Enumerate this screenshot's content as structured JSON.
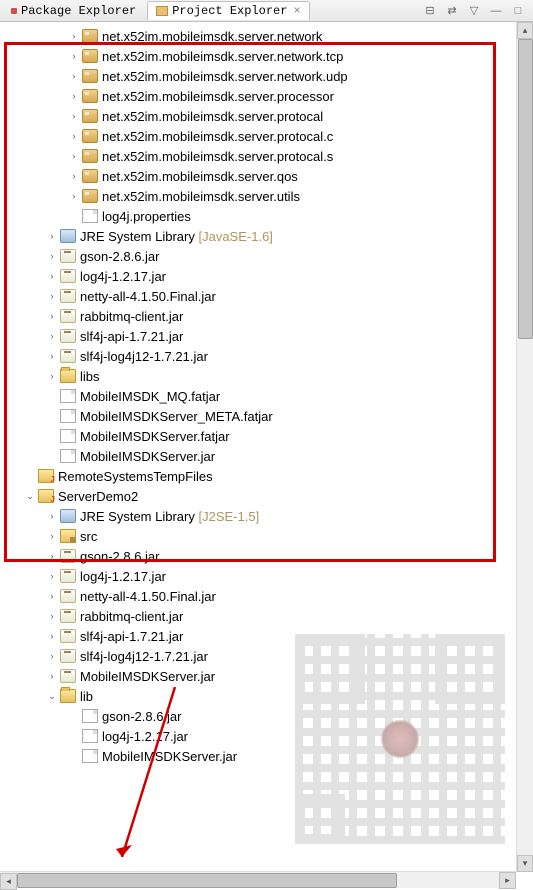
{
  "tabs": {
    "inactive": "Package Explorer",
    "active": "Project Explorer",
    "active_marker": "×"
  },
  "toolbar": {
    "collapse": "⊟",
    "link": "⇄",
    "menu": "▽",
    "min": "—",
    "max": "□"
  },
  "tree": [
    {
      "indent": 3,
      "exp": ">",
      "ico": "pkg",
      "text": "net.x52im.mobileimsdk.server.network"
    },
    {
      "indent": 3,
      "exp": ">",
      "ico": "pkg",
      "text": "net.x52im.mobileimsdk.server.network.tcp"
    },
    {
      "indent": 3,
      "exp": ">",
      "ico": "pkg",
      "text": "net.x52im.mobileimsdk.server.network.udp"
    },
    {
      "indent": 3,
      "exp": ">",
      "ico": "pkg",
      "text": "net.x52im.mobileimsdk.server.processor"
    },
    {
      "indent": 3,
      "exp": ">",
      "ico": "pkg",
      "text": "net.x52im.mobileimsdk.server.protocal"
    },
    {
      "indent": 3,
      "exp": ">",
      "ico": "pkg",
      "text": "net.x52im.mobileimsdk.server.protocal.c"
    },
    {
      "indent": 3,
      "exp": ">",
      "ico": "pkg",
      "text": "net.x52im.mobileimsdk.server.protocal.s"
    },
    {
      "indent": 3,
      "exp": ">",
      "ico": "pkg",
      "text": "net.x52im.mobileimsdk.server.qos"
    },
    {
      "indent": 3,
      "exp": ">",
      "ico": "pkg",
      "text": "net.x52im.mobileimsdk.server.utils"
    },
    {
      "indent": 3,
      "exp": "",
      "ico": "file",
      "text": "log4j.properties"
    },
    {
      "indent": 2,
      "exp": ">",
      "ico": "lib",
      "text": "JRE System Library",
      "deco": " [JavaSE-1.6]"
    },
    {
      "indent": 2,
      "exp": ">",
      "ico": "jar",
      "text": "gson-2.8.6.jar"
    },
    {
      "indent": 2,
      "exp": ">",
      "ico": "jar",
      "text": "log4j-1.2.17.jar"
    },
    {
      "indent": 2,
      "exp": ">",
      "ico": "jar",
      "text": "netty-all-4.1.50.Final.jar"
    },
    {
      "indent": 2,
      "exp": ">",
      "ico": "jar",
      "text": "rabbitmq-client.jar"
    },
    {
      "indent": 2,
      "exp": ">",
      "ico": "jar",
      "text": "slf4j-api-1.7.21.jar"
    },
    {
      "indent": 2,
      "exp": ">",
      "ico": "jar",
      "text": "slf4j-log4j12-1.7.21.jar"
    },
    {
      "indent": 2,
      "exp": ">",
      "ico": "folder",
      "text": "libs"
    },
    {
      "indent": 2,
      "exp": "",
      "ico": "file",
      "text": "MobileIMSDK_MQ.fatjar"
    },
    {
      "indent": 2,
      "exp": "",
      "ico": "file",
      "text": "MobileIMSDKServer_META.fatjar"
    },
    {
      "indent": 2,
      "exp": "",
      "ico": "file",
      "text": "MobileIMSDKServer.fatjar"
    },
    {
      "indent": 2,
      "exp": "",
      "ico": "file",
      "text": "MobileIMSDKServer.jar"
    },
    {
      "indent": 1,
      "exp": "",
      "ico": "proj",
      "text": "RemoteSystemsTempFiles"
    },
    {
      "indent": 1,
      "exp": "v",
      "ico": "proj",
      "text": "ServerDemo2"
    },
    {
      "indent": 2,
      "exp": ">",
      "ico": "lib",
      "text": "JRE System Library",
      "deco": " [J2SE-1.5]"
    },
    {
      "indent": 2,
      "exp": ">",
      "ico": "src",
      "text": "src"
    },
    {
      "indent": 2,
      "exp": ">",
      "ico": "jar",
      "text": "gson-2.8.6.jar"
    },
    {
      "indent": 2,
      "exp": ">",
      "ico": "jar",
      "text": "log4j-1.2.17.jar"
    },
    {
      "indent": 2,
      "exp": ">",
      "ico": "jar",
      "text": "netty-all-4.1.50.Final.jar"
    },
    {
      "indent": 2,
      "exp": ">",
      "ico": "jar",
      "text": "rabbitmq-client.jar"
    },
    {
      "indent": 2,
      "exp": ">",
      "ico": "jar",
      "text": "slf4j-api-1.7.21.jar"
    },
    {
      "indent": 2,
      "exp": ">",
      "ico": "jar",
      "text": "slf4j-log4j12-1.7.21.jar"
    },
    {
      "indent": 2,
      "exp": ">",
      "ico": "jar",
      "text": "MobileIMSDKServer.jar"
    },
    {
      "indent": 2,
      "exp": "v",
      "ico": "folder",
      "text": "lib"
    },
    {
      "indent": 3,
      "exp": "",
      "ico": "file",
      "text": "gson-2.8.6.jar"
    },
    {
      "indent": 3,
      "exp": "",
      "ico": "file",
      "text": "log4j-1.2.17.jar"
    },
    {
      "indent": 3,
      "exp": "",
      "ico": "file",
      "text": "MobileIMSDKServer.jar"
    }
  ]
}
